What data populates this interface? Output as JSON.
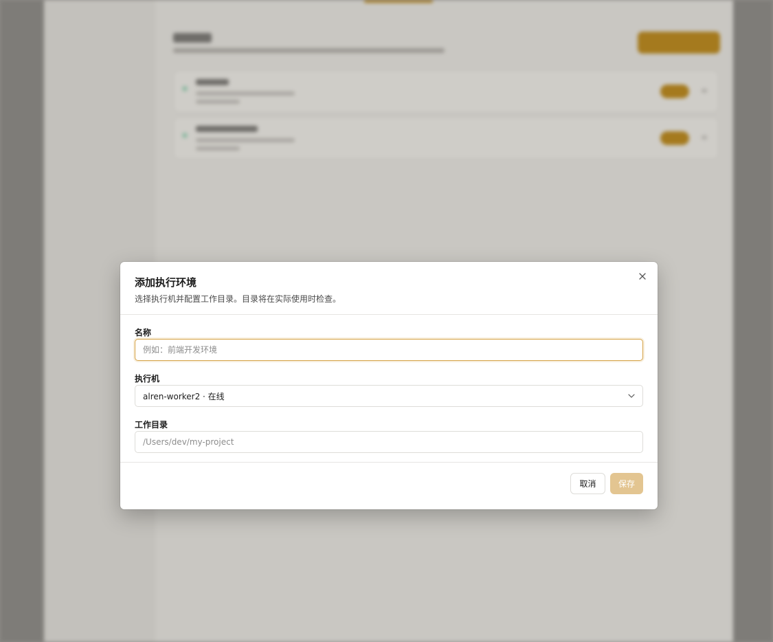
{
  "dialog": {
    "title": "添加执行环境",
    "description": "选择执行机并配置工作目录。目录将在实际使用时检查。",
    "name_label": "名称",
    "name_placeholder": "例如：前端开发环境",
    "executor_label": "执行机",
    "executor_value": "alren-worker2 · 在线",
    "workdir_label": "工作目录",
    "workdir_placeholder": "/Users/dev/my-project",
    "cancel_label": "取消",
    "save_label": "保存"
  },
  "colors": {
    "accent": "#d6a44a",
    "save_disabled": "#e3c591",
    "overlay": "#8f8d89"
  },
  "icons": {
    "close": "close-icon",
    "select": "chevron-down-icon"
  }
}
